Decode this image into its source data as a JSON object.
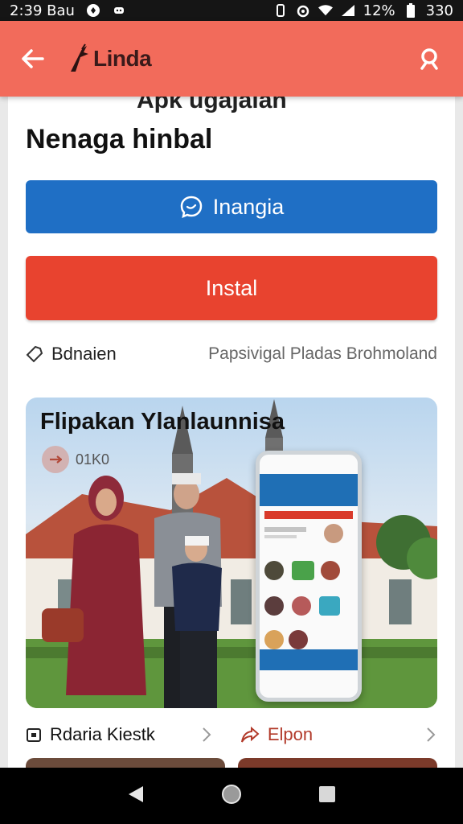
{
  "status_bar": {
    "time": "2:39 Bau",
    "battery": "12%",
    "signal_text": "330"
  },
  "app_bar": {
    "brand": "Linda"
  },
  "main": {
    "faded_title": "Apk ugajalan",
    "title": "Nenaga hinbal",
    "primary_button": "Inangia",
    "install_button": "Instal",
    "info_label": "Bdnaien",
    "info_meta": "Papsivigal Pladas Brohmoland"
  },
  "banner": {
    "title": "Flipakan Ylanlaunnisa",
    "badge": "01K0"
  },
  "bottom": {
    "left_label": "Rdaria Kiestk",
    "right_label": "Elpon"
  },
  "colors": {
    "app_bar": "#f26b5b",
    "primary": "#1f6fc5",
    "install": "#e8432f"
  }
}
